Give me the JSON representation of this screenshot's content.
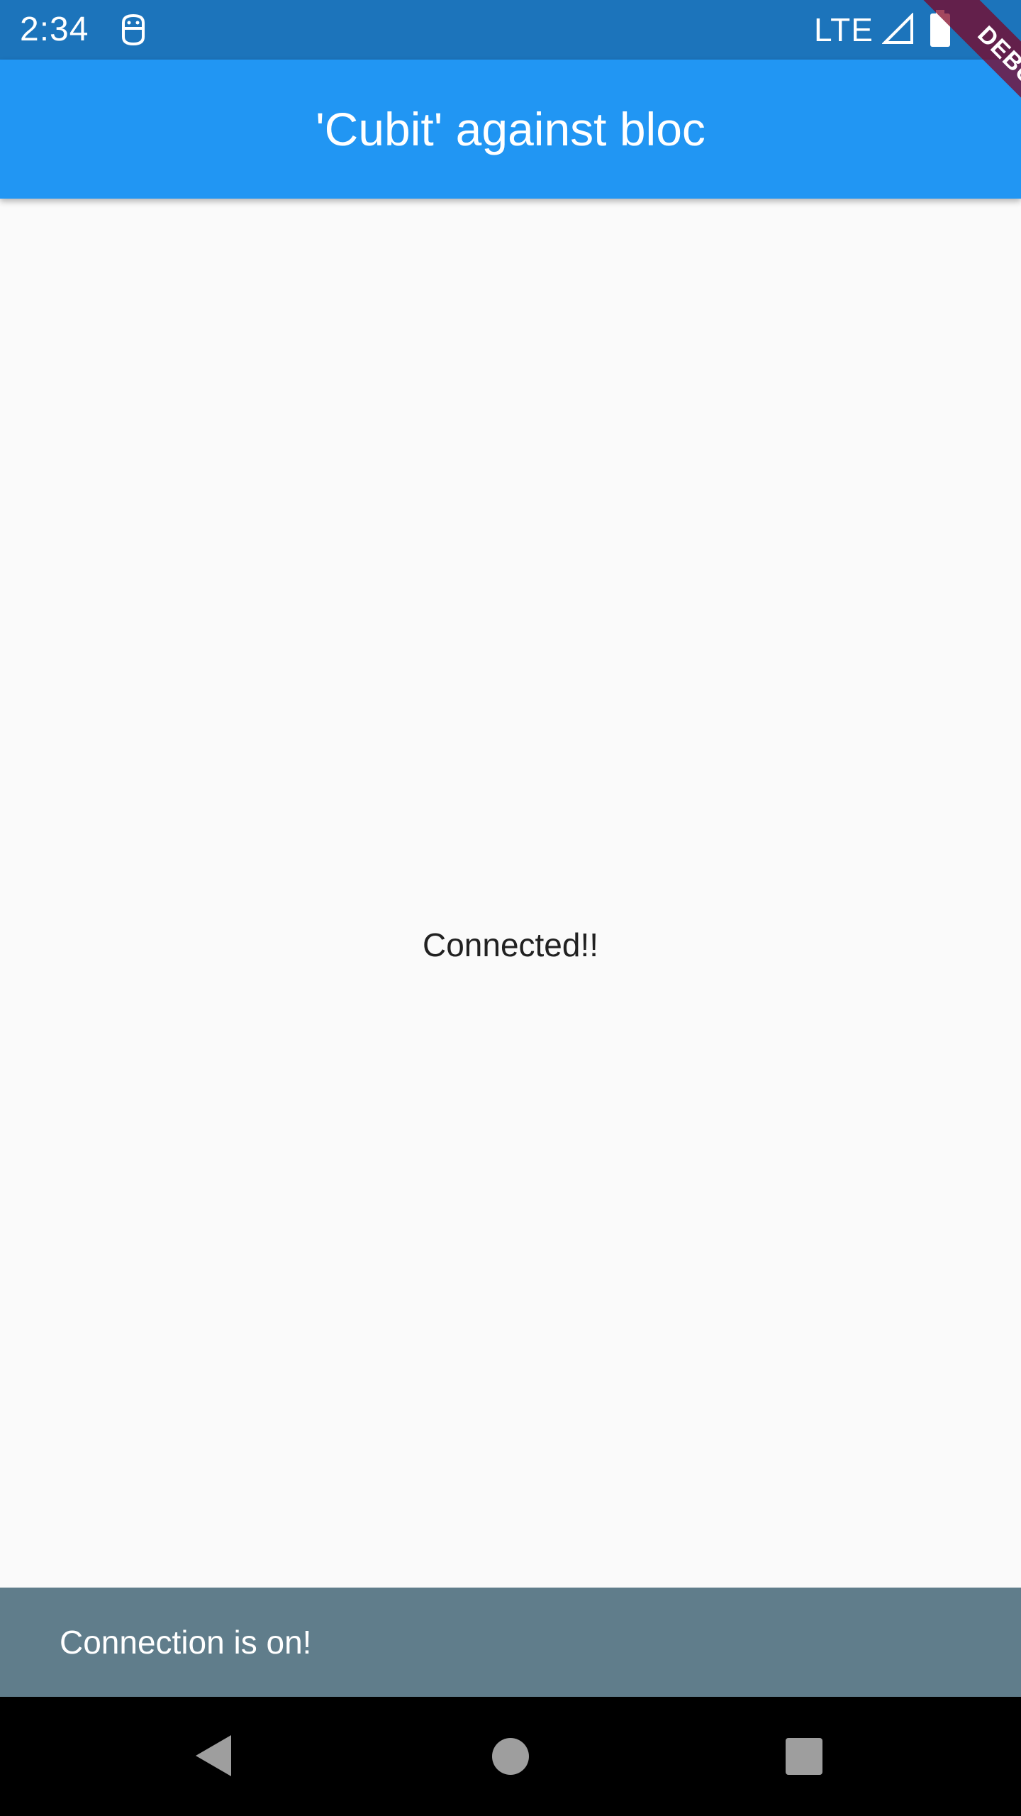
{
  "status_bar": {
    "time": "2:34",
    "network": "LTE",
    "app_icon": "android-debug-icon",
    "signal_icon": "signal-icon",
    "battery_icon": "battery-icon",
    "color": "#1c74bb"
  },
  "app_bar": {
    "title": "'Cubit' against bloc",
    "color": "#2196f3"
  },
  "debug_banner": {
    "label": "DEBUG"
  },
  "content": {
    "status_text": "Connected!!"
  },
  "snackbar": {
    "message": "Connection is on!",
    "color": "#607d8b"
  },
  "nav_bar": {
    "back_icon": "back-triangle-icon",
    "home_icon": "home-circle-icon",
    "recents_icon": "recents-square-icon"
  }
}
